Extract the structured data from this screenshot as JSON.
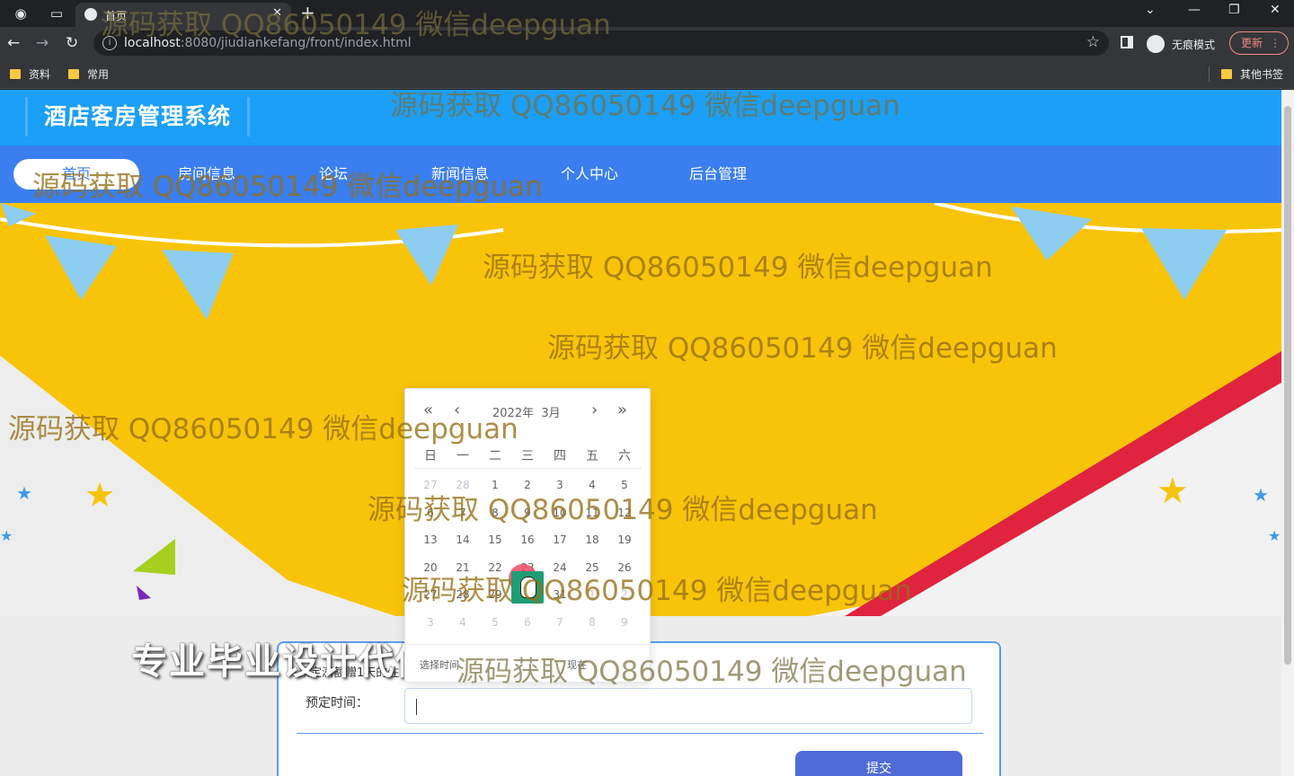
{
  "browser": {
    "tab_title": "首页",
    "new_tab_symbol": "+",
    "close_symbol": "✕",
    "url_host": "localhost",
    "url_path": ":8080/jiudiankefang/front/index.html",
    "info_symbol": "i",
    "incognito_label": "无痕模式",
    "update_label": "更新",
    "bookmarks": [
      "资料",
      "常用"
    ],
    "other_bookmarks": "其他书签"
  },
  "site": {
    "title": "酒店客房管理系统",
    "nav": [
      "首页",
      "房间信息",
      "论坛",
      "新闻信息",
      "个人中心",
      "后台管理"
    ],
    "active_nav_index": 0,
    "promo_text": "专业毕业设计代做"
  },
  "booking_form": {
    "hint": "预定满额赠1天的住",
    "date_label": "预定时间：",
    "date_value": "",
    "submit_label": "提交"
  },
  "calendar": {
    "year_label": "2022年",
    "month_label": "3月",
    "weekdays": [
      "日",
      "一",
      "二",
      "三",
      "四",
      "五",
      "六"
    ],
    "rows": [
      [
        "27",
        "28",
        "1",
        "2",
        "3",
        "4",
        "5"
      ],
      [
        "6",
        "7",
        "8",
        "9",
        "10",
        "11",
        "12"
      ],
      [
        "13",
        "14",
        "15",
        "16",
        "17",
        "18",
        "19"
      ],
      [
        "20",
        "21",
        "22",
        "23",
        "24",
        "25",
        "26"
      ],
      [
        "27",
        "28",
        "29",
        "30",
        "31",
        "1",
        "2"
      ],
      [
        "3",
        "4",
        "5",
        "6",
        "7",
        "8",
        "9"
      ]
    ],
    "footer_left": "选择时间",
    "footer_right": "现在"
  },
  "watermark": "源码获取 QQ86050149 微信deepguan",
  "colors": {
    "header_blue": "#1c9ff6",
    "nav_blue": "#3a7ef0",
    "banner_yellow": "#f8c40a",
    "submit_blue": "#4f6bd6",
    "today_red": "#f04c63"
  }
}
